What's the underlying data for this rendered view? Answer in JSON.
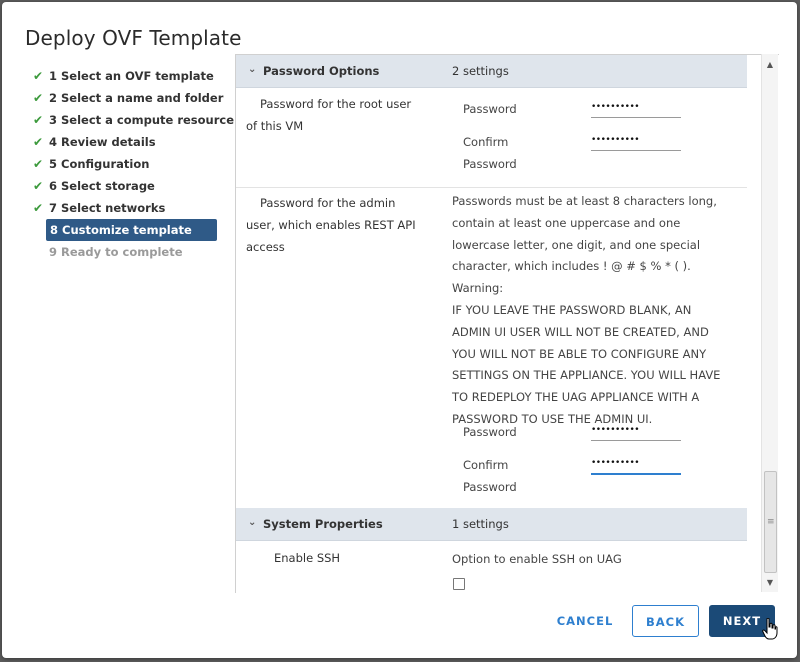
{
  "window": {
    "title": "Deploy OVF Template"
  },
  "steps": [
    {
      "label": "1 Select an OVF template",
      "state": "done"
    },
    {
      "label": "2 Select a name and folder",
      "state": "done"
    },
    {
      "label": "3 Select a compute resource",
      "state": "done"
    },
    {
      "label": "4 Review details",
      "state": "done"
    },
    {
      "label": "5 Configuration",
      "state": "done"
    },
    {
      "label": "6 Select storage",
      "state": "done"
    },
    {
      "label": "7 Select networks",
      "state": "done"
    },
    {
      "label": "8 Customize template",
      "state": "active"
    },
    {
      "label": "9 Ready to complete",
      "state": "disabled"
    }
  ],
  "sections": {
    "password_options": {
      "name": "Password Options",
      "count": "2 settings",
      "root": {
        "label_line1": "Password for the root user",
        "label_line2": "of this VM",
        "password_label": "Password",
        "password_value": "••••••••••",
        "confirm_label_line1": "Confirm",
        "confirm_label_line2": "Password",
        "confirm_value": "••••••••••"
      },
      "admin": {
        "label_line1": "Password for the admin",
        "label_line2": "user, which enables REST API",
        "label_line3": "access",
        "note_lines": [
          "Passwords must be at least 8 characters long,",
          "contain at least one uppercase and one",
          "lowercase letter, one digit, and one special",
          "character, which includes ! @ # $ % * ( ). Warning:",
          "IF YOU LEAVE THE PASSWORD BLANK, AN",
          "ADMIN UI USER WILL NOT BE CREATED, AND",
          "YOU WILL NOT BE ABLE TO CONFIGURE ANY",
          "SETTINGS ON THE APPLIANCE. YOU WILL HAVE",
          "TO REDEPLOY THE UAG APPLIANCE WITH A",
          "PASSWORD TO USE THE ADMIN UI."
        ],
        "password_label": "Password",
        "password_value": "••••••••••",
        "confirm_label_line1": "Confirm",
        "confirm_label_line2": "Password",
        "confirm_value": "••••••••••"
      }
    },
    "system_properties": {
      "name": "System Properties",
      "count": "1 settings",
      "ssh": {
        "label": "Enable SSH",
        "description": "Option to enable SSH on UAG",
        "checked": false
      }
    }
  },
  "buttons": {
    "cancel": "CANCEL",
    "back": "BACK",
    "next": "NEXT"
  },
  "icons": {
    "check": "✔",
    "chevron": "⌄",
    "scroll_up": "▲",
    "scroll_down": "▼",
    "grip": "≡"
  },
  "colors": {
    "accent": "#2e7fcf",
    "active_step": "#2f5a87",
    "primary_button": "#1b4a77",
    "check": "#3c9a3c",
    "section_header": "#dfe5ec"
  }
}
